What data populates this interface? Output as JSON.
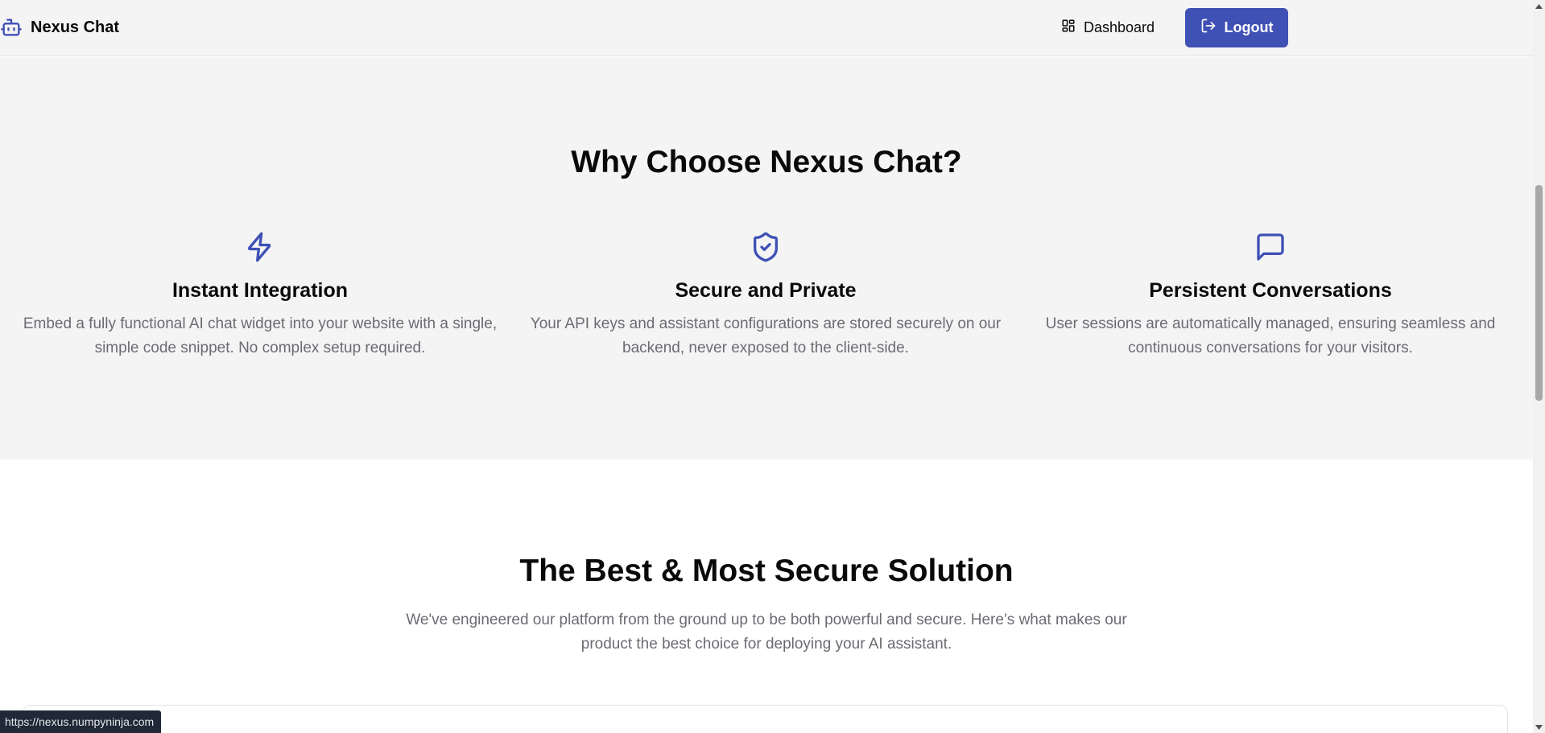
{
  "header": {
    "brand_name": "Nexus Chat",
    "brand_icon": "bot-icon",
    "nav": {
      "dashboard_label": "Dashboard",
      "dashboard_icon": "layout-dashboard-icon",
      "logout_label": "Logout",
      "logout_icon": "log-out-icon"
    }
  },
  "features": {
    "title": "Why Choose Nexus Chat?",
    "items": [
      {
        "icon": "zap-icon",
        "title": "Instant Integration",
        "description": "Embed a fully functional AI chat widget into your website with a single, simple code snippet. No complex setup required."
      },
      {
        "icon": "shield-check-icon",
        "title": "Secure and Private",
        "description": "Your API keys and assistant configurations are stored securely on our backend, never exposed to the client-side."
      },
      {
        "icon": "message-square-icon",
        "title": "Persistent Conversations",
        "description": "User sessions are automatically managed, ensuring seamless and continuous conversations for your visitors."
      }
    ]
  },
  "secure": {
    "title": "The Best & Most Secure Solution",
    "subtitle": "We've engineered our platform from the ground up to be both powerful and secure. Here’s what makes our product the best choice for deploying your AI assistant."
  },
  "status_bar": {
    "url": "https://nexus.numpyninja.com"
  },
  "colors": {
    "accent": "#3f51b5",
    "section_bg": "#f4f4f5",
    "muted_text": "#6b6b72",
    "heading_text": "#0a0a0a"
  }
}
